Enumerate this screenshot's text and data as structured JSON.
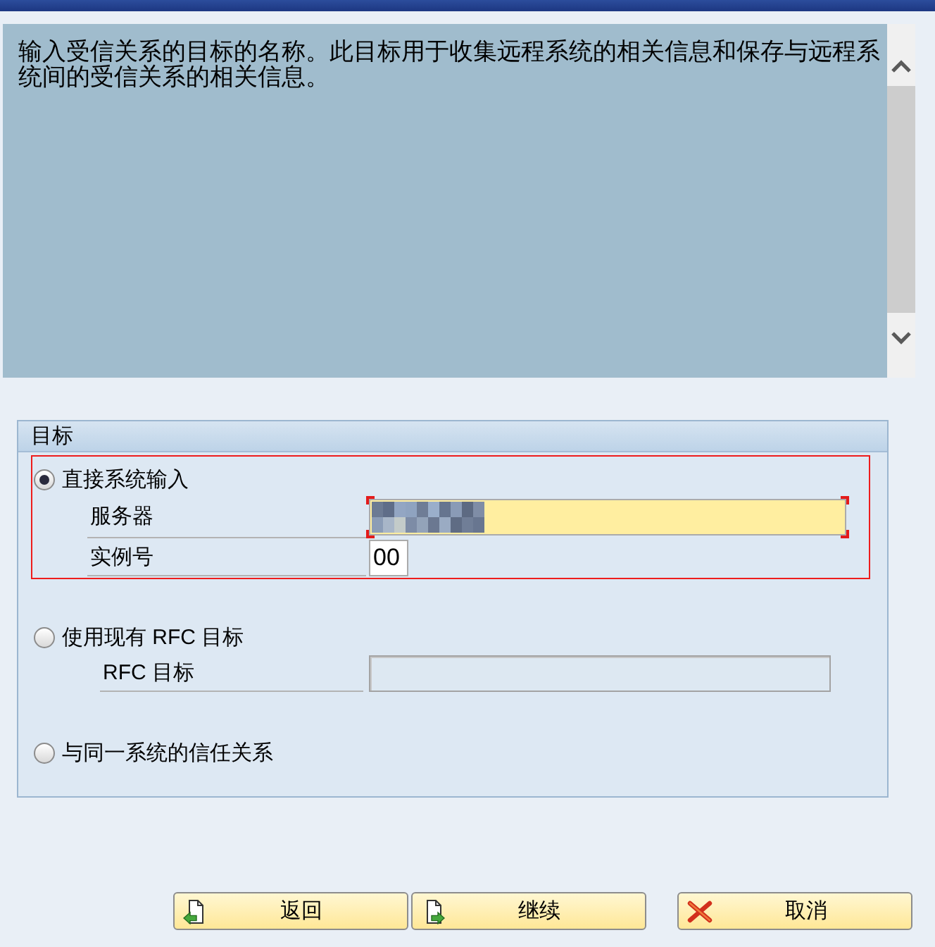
{
  "help_text": "输入受信关系的目标的名称。此目标用于收集远程系统的相关信息和保存与远程系统间的受信关系的相关信息。",
  "group": {
    "title": "目标",
    "options": [
      {
        "label": "直接系统输入",
        "selected": true,
        "highlighted": true,
        "fields": [
          {
            "label": "服务器",
            "focused": true,
            "disabled": false,
            "redacted": true
          },
          {
            "label": "实例号",
            "focused": false,
            "disabled": false,
            "redacted": false,
            "value": "00"
          }
        ]
      },
      {
        "label": "使用现有 RFC 目标",
        "selected": false,
        "highlighted": false,
        "fields": [
          {
            "label": "RFC 目标",
            "focused": false,
            "disabled": true,
            "redacted": false
          }
        ]
      },
      {
        "label": "与同一系统的信任关系",
        "selected": false,
        "highlighted": false
      }
    ]
  },
  "buttons": [
    {
      "label": "返回",
      "kind": "back"
    },
    {
      "label": "继续",
      "kind": "continue"
    },
    {
      "label": "取消",
      "kind": "cancel"
    }
  ]
}
